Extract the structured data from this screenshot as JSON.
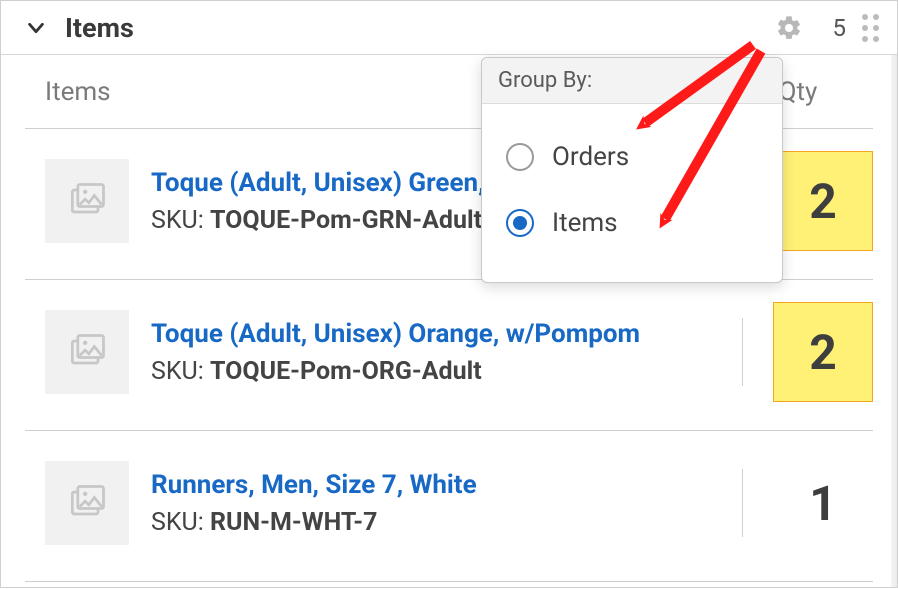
{
  "header": {
    "title": "Items",
    "count": "5"
  },
  "columns": {
    "items": "Items",
    "qty": "Qty"
  },
  "rows": [
    {
      "title": "Toque (Adult, Unisex) Green, w/Pompom",
      "sku_label": "SKU: ",
      "sku": "TOQUE-Pom-GRN-Adult",
      "qty": "2",
      "highlight": true
    },
    {
      "title": "Toque (Adult, Unisex) Orange, w/Pompom",
      "sku_label": "SKU: ",
      "sku": "TOQUE-Pom-ORG-Adult",
      "qty": "2",
      "highlight": true
    },
    {
      "title": "Runners, Men, Size 7, White",
      "sku_label": "SKU: ",
      "sku": "RUN-M-WHT-7",
      "qty": "1",
      "highlight": false
    }
  ],
  "popover": {
    "header": "Group By:",
    "options": {
      "orders": "Orders",
      "items": "Items"
    },
    "selected": "items"
  }
}
